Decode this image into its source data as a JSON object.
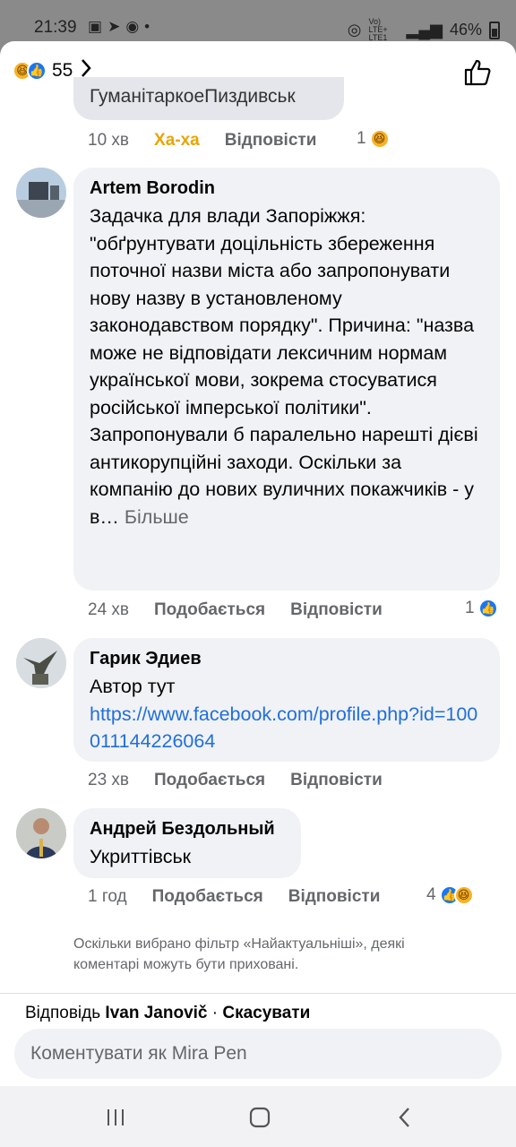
{
  "status_bar": {
    "time": "21:39",
    "notif_icons": [
      "gallery-icon",
      "telegram-icon",
      "messenger-icon",
      "dot"
    ],
    "network_label": "Vo) LTE+ LTE1",
    "battery": "46%"
  },
  "header": {
    "reaction_count": "55",
    "reactions": [
      "haha",
      "like"
    ]
  },
  "cut_comment": {
    "text": "ГуманітаркоеПиздивськ",
    "time": "10 хв",
    "haha_label": "Ха-ха",
    "reply_label": "Відповісти",
    "reaction_count": "1"
  },
  "comments": [
    {
      "author": "Artem Borodin",
      "text": "Задачка для влади Запоріжжя: \"обґрунтувати доцільність збереження поточної назви міста або запропонувати нову назву в установленому законодавством порядку\". Причина: \"назва може не відповідати лексичним нормам української мови, зокрема стосуватися російської імперської політики\". Запропонували б паралельно нарешті дієві антикорупційні заходи. Оскільки за компанію до нових вуличних покажчиків - у в…",
      "more": "Більше",
      "time": "24 хв",
      "like_label": "Подобається",
      "reply_label": "Відповісти",
      "reaction_count": "1"
    },
    {
      "author": "Гарик Эдиев",
      "text": "Автор тут",
      "link": "https://www.facebook.com/profile.php?id=100011144226064",
      "time": "23 хв",
      "like_label": "Подобається",
      "reply_label": "Відповісти"
    },
    {
      "author": "Андрей Бездольный",
      "text": "Укриттівськ",
      "time": "1 год",
      "like_label": "Подобається",
      "reply_label": "Відповісти",
      "reaction_count": "4"
    }
  ],
  "notice": "Оскільки вибрано фільтр «Найактуальніші», деякі коментарі можуть бути приховані.",
  "reply_bar": {
    "prefix": "Відповідь",
    "name": "Ivan Janovič",
    "sep": " · ",
    "cancel": "Скасувати"
  },
  "comment_input": {
    "placeholder": "Коментувати як Mira Pen"
  },
  "colors": {
    "accent": "#1877f2",
    "haha": "#f7b125",
    "bubble": "#f0f2f5",
    "secondary_text": "#65676b",
    "link": "#216fdb"
  }
}
